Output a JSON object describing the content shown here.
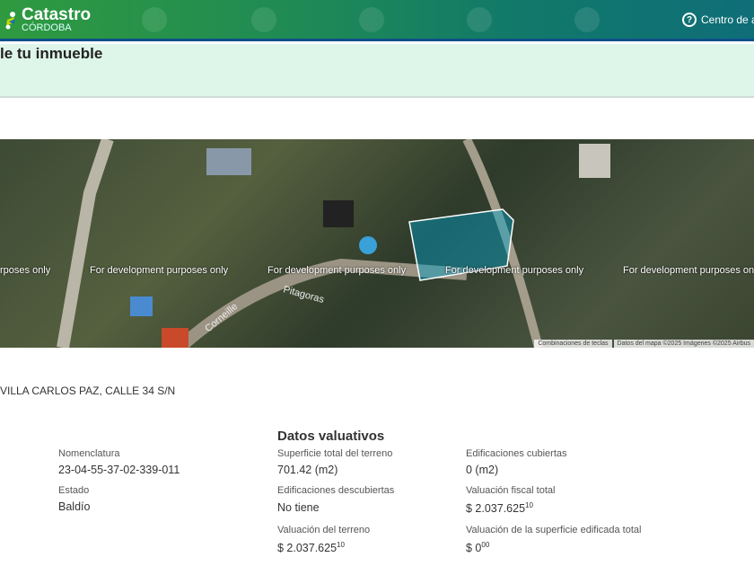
{
  "header": {
    "brand": "Catastro",
    "brand_sub": "CÓRDOBA",
    "help": "Centro de ay"
  },
  "page_title": "le tu inmueble",
  "map": {
    "watermark": "For development purposes only",
    "watermark_clipped": "rposes only",
    "street1": "Pitagoras",
    "street2": "Corneille",
    "shortcuts": "Combinaciones de teclas",
    "attribution": "Datos del mapa ©2025 Imágenes ©2025 Airbus"
  },
  "address": "VILLA CARLOS PAZ, CALLE 34 S/N",
  "general": {
    "nomenclatura_label": "Nomenclatura",
    "nomenclatura": "23-04-55-37-02-339-011",
    "estado_label": "Estado",
    "estado": "Baldío"
  },
  "valuativos": {
    "title": "Datos valuativos",
    "sup_label": "Superficie total del terreno",
    "sup": "701.42 (m2)",
    "desc_label": "Edificaciones descubiertas",
    "desc": "No tiene",
    "valterr_label": "Valuación del terreno",
    "valterr": "$ 2.037.625",
    "valterr_cents": "10",
    "cub_label": "Edificaciones cubiertas",
    "cub": "0 (m2)",
    "fiscal_label": "Valuación fiscal total",
    "fiscal": "$ 2.037.625",
    "fiscal_cents": "10",
    "edif_label": "Valuación de la superficie edificada total",
    "edif": "$ 0",
    "edif_cents": "00"
  }
}
